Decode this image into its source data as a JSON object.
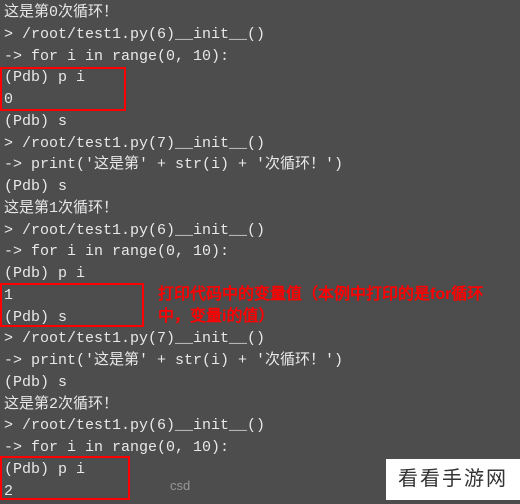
{
  "lines": {
    "l0": "这是第0次循环！",
    "l1": "> /root/test1.py(6)__init__()",
    "l2": "-> for i in range(0, 10):",
    "l3": "(Pdb) p i",
    "l4": "0",
    "l5": "(Pdb) s",
    "l6": "> /root/test1.py(7)__init__()",
    "l7": "-> print('这是第' + str(i) + '次循环！')",
    "l8": "(Pdb) s",
    "l9": "这是第1次循环！",
    "l10": "> /root/test1.py(6)__init__()",
    "l11": "-> for i in range(0, 10):",
    "l12": "(Pdb) p i",
    "l13": "1",
    "l14": "(Pdb) s",
    "l15": "> /root/test1.py(7)__init__()",
    "l16": "-> print('这是第' + str(i) + '次循环！')",
    "l17": "(Pdb) s",
    "l18": "这是第2次循环！",
    "l19": "> /root/test1.py(6)__init__()",
    "l20": "-> for i in range(0, 10):",
    "l21": "(Pdb) p i",
    "l22": "2"
  },
  "annotations": {
    "a1": "打印代码中的变量值（本例中打印的是for循环中，变量i的值）"
  },
  "watermarks": {
    "csdn": "csd",
    "brand": "看看手游网"
  },
  "colors": {
    "background": "#4d4d4d",
    "text": "#e8e8e8",
    "highlight": "#ff0000",
    "annotation": "#ff0000"
  }
}
